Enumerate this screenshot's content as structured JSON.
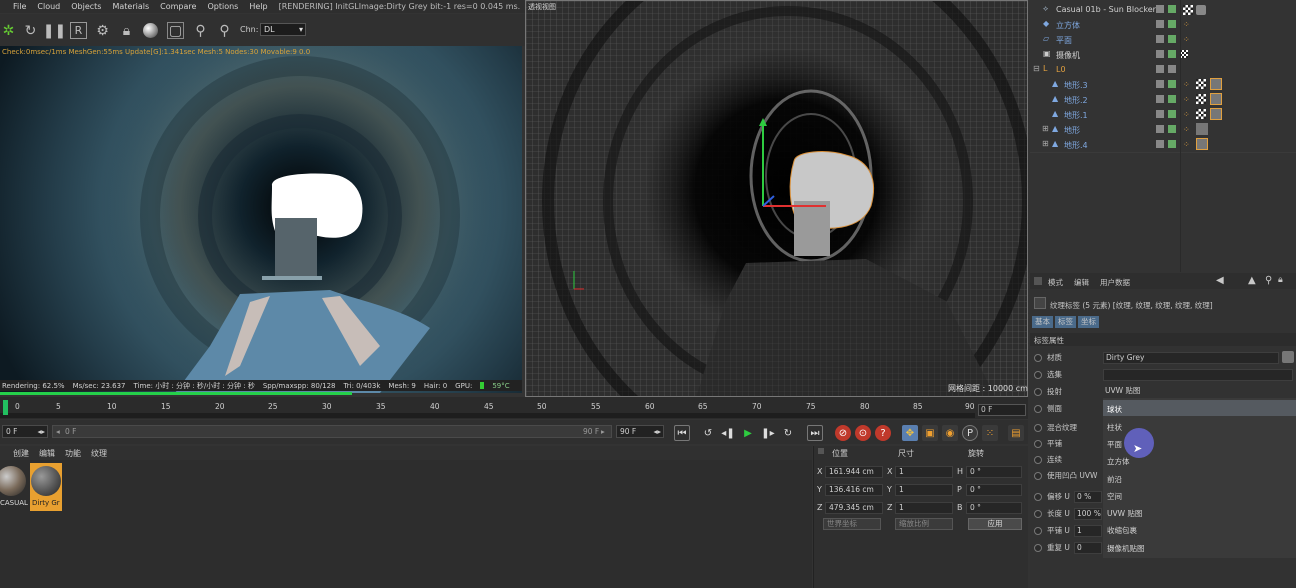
{
  "menu": {
    "items": [
      "File",
      "Cloud",
      "Objects",
      "Materials",
      "Compare",
      "Options",
      "Help"
    ],
    "title": "[RENDERING] InitGLImage:Dirty Grey  bit:-1 res=0  0.045 ms."
  },
  "toolbar": {
    "icons": [
      "refresh-icon",
      "redo-icon",
      "pause-icon",
      "render-region-icon",
      "settings-icon",
      "lock-icon",
      "sphere-icon",
      "frame-icon",
      "pin-icon",
      "pin-alt-icon"
    ],
    "chn_label": "Chn:",
    "chn_value": "DL"
  },
  "render_view": {
    "status": "Check:0msec/1ms  MeshGen:55ms  Update[G]:1.341sec  Mesh:5 Nodes:30 Movable:9  0.0",
    "info": [
      "Rendering: 62.5%",
      "Ms/sec: 23.637",
      "Time: 小时 : 分钟 : 秒/小时 : 分钟 : 秒",
      "Spp/maxspp: 80/128",
      "Tri: 0/403k",
      "Mesh: 9",
      "Hair: 0",
      "GPU:",
      "59°C"
    ],
    "progress": 0.625
  },
  "editor_view": {
    "label": "透视视图",
    "scale": "网格间距 : 10000 cm"
  },
  "objects": [
    {
      "name": "Casual 01b - Sun Blocker",
      "color": "normal",
      "indent": 0
    },
    {
      "name": "立方体",
      "color": "blue",
      "indent": 0
    },
    {
      "name": "平面",
      "color": "blue",
      "indent": 0
    },
    {
      "name": "摄像机",
      "color": "normal",
      "indent": 0
    },
    {
      "name": "L0",
      "color": "orange",
      "indent": 0
    },
    {
      "name": "地形.3",
      "color": "blue",
      "indent": 1
    },
    {
      "name": "地形.2",
      "color": "blue",
      "indent": 1
    },
    {
      "name": "地形.1",
      "color": "blue",
      "indent": 1
    },
    {
      "name": "地形",
      "color": "blue",
      "indent": 1
    },
    {
      "name": "地形.4",
      "color": "blue",
      "indent": 1
    }
  ],
  "attributes": {
    "menu": [
      "模式",
      "编辑",
      "用户数据"
    ],
    "header": "纹理标签 (5 元素) [纹理, 纹理, 纹理, 纹理, 纹理]",
    "tabs": [
      "基本",
      "标签",
      "坐标"
    ],
    "section": "标签属性",
    "rows": [
      {
        "label": "材质",
        "value": "Dirty Grey"
      },
      {
        "label": "选集",
        "value": ""
      },
      {
        "label": "投射",
        "value": "UVW 贴图"
      },
      {
        "label": "侧面",
        "value": "球状"
      },
      {
        "label": "混合纹理",
        "value": ""
      },
      {
        "label": "平铺",
        "value": ""
      },
      {
        "label": "连续",
        "value": ""
      },
      {
        "label": "使用凹凸 UVW",
        "value": ""
      },
      {
        "label": "偏移 U",
        "value": "0 %"
      },
      {
        "label": "长度 U",
        "value": "100 %"
      },
      {
        "label": "平铺 U",
        "value": "1"
      },
      {
        "label": "重复 U",
        "value": "0"
      }
    ],
    "dropdown": [
      "球状",
      "柱状",
      "平面",
      "立方体",
      "前沿",
      "空间",
      "UVW 贴图",
      "收缩包裹",
      "摄像机贴图"
    ]
  },
  "timeline": {
    "ticks": [
      "0",
      "5",
      "10",
      "15",
      "20",
      "25",
      "30",
      "35",
      "40",
      "45",
      "50",
      "55",
      "60",
      "65",
      "70",
      "75",
      "80",
      "85",
      "90"
    ],
    "current_frame": "0 F"
  },
  "transport": {
    "start": "0 F",
    "slider_start": "0 F",
    "slider_end": "90 F",
    "end": "90 F"
  },
  "materials": {
    "menu": [
      "创建",
      "编辑",
      "功能",
      "纹理"
    ],
    "items": [
      {
        "label": "CASUAL",
        "selected": false
      },
      {
        "label": "Dirty Gr",
        "selected": true
      }
    ]
  },
  "coordinates": {
    "headers": [
      "位置",
      "尺寸",
      "旋转"
    ],
    "rows": [
      {
        "axis": "X",
        "pos": "161.944 cm",
        "size_axis": "X",
        "size": "1",
        "rot_axis": "H",
        "rot": "0 °"
      },
      {
        "axis": "Y",
        "pos": "136.416 cm",
        "size_axis": "Y",
        "size": "1",
        "rot_axis": "P",
        "rot": "0 °"
      },
      {
        "axis": "Z",
        "pos": "479.345 cm",
        "size_axis": "Z",
        "size": "1",
        "rot_axis": "B",
        "rot": "0 °"
      }
    ],
    "mode1": "世界坐标",
    "mode2": "缩放比例",
    "apply": "应用"
  }
}
